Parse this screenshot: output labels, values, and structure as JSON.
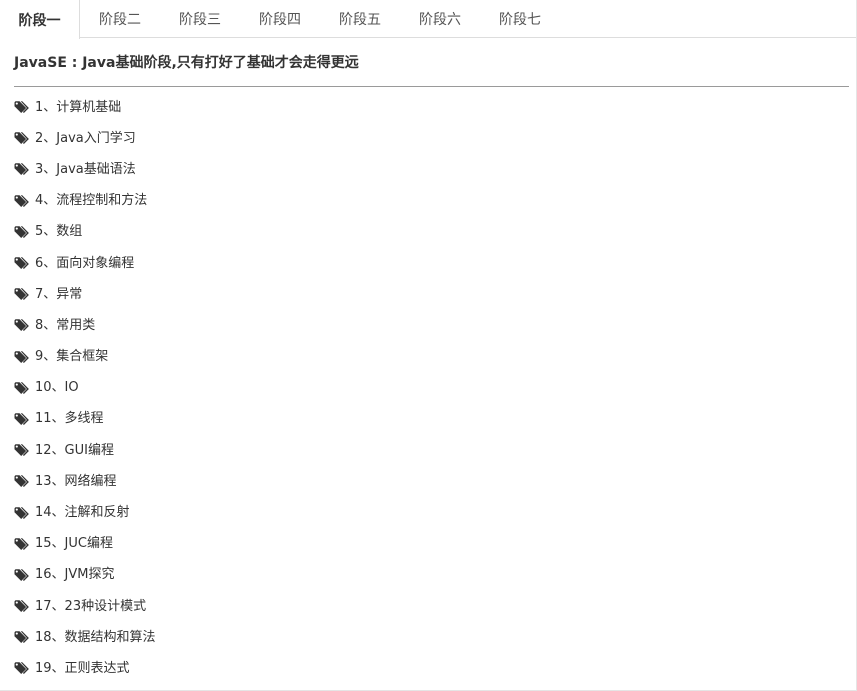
{
  "tabs": [
    {
      "label": "阶段一",
      "active": true
    },
    {
      "label": "阶段二",
      "active": false
    },
    {
      "label": "阶段三",
      "active": false
    },
    {
      "label": "阶段四",
      "active": false
    },
    {
      "label": "阶段五",
      "active": false
    },
    {
      "label": "阶段六",
      "active": false
    },
    {
      "label": "阶段七",
      "active": false
    }
  ],
  "content": {
    "title": "JavaSE : Java基础阶段,只有打好了基础才会走得更远",
    "items": [
      "1、计算机基础",
      "2、Java入门学习",
      "3、Java基础语法",
      "4、流程控制和方法",
      "5、数组",
      "6、面向对象编程",
      "7、异常",
      "8、常用类",
      "9、集合框架",
      "10、IO",
      "11、多线程",
      "12、GUI编程",
      "13、网络编程",
      "14、注解和反射",
      "15、JUC编程",
      "16、JVM探究",
      "17、23种设计模式",
      "18、数据结构和算法",
      "19、正则表达式"
    ]
  },
  "icons": {
    "item": "tags-icon"
  },
  "colors": {
    "text": "#333333",
    "tab_text": "#555555",
    "border": "#dddddd",
    "divider": "#9a9a9a",
    "icon": "#333333"
  }
}
